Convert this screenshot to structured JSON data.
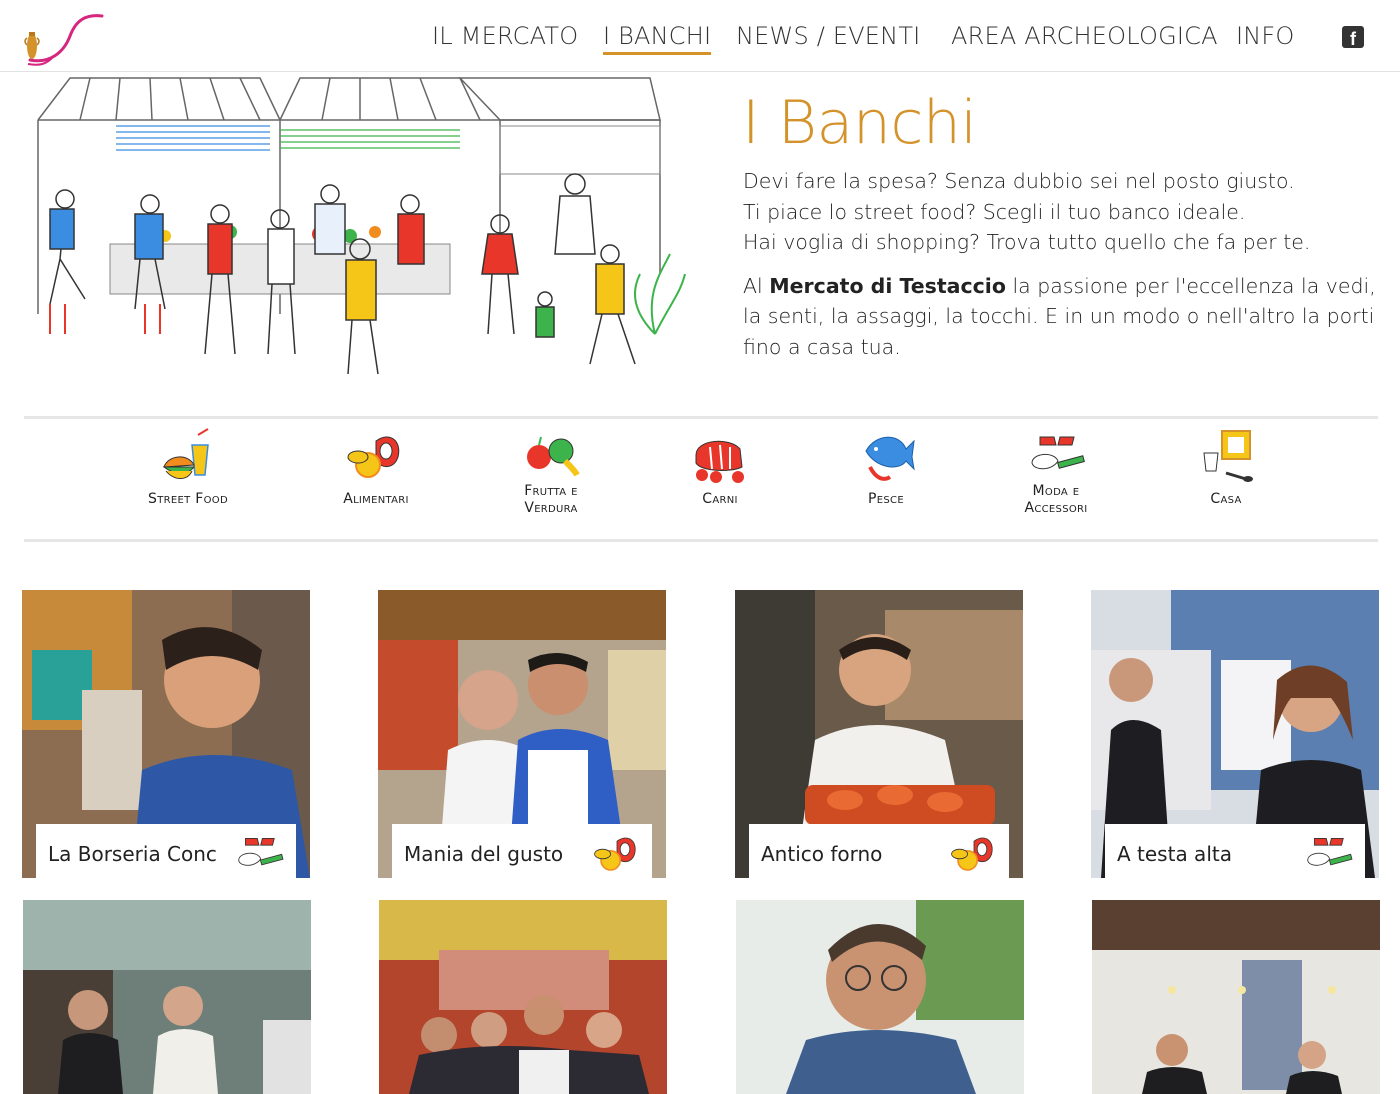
{
  "nav": {
    "items": [
      {
        "label": "IL MERCATO"
      },
      {
        "label": "I BANCHI"
      },
      {
        "label": "NEWS / EVENTI"
      },
      {
        "label": "AREA ARCHEOLOGICA"
      },
      {
        "label": "INFO"
      }
    ],
    "active_index": 1,
    "facebook_icon": "facebook-icon"
  },
  "hero": {
    "title": "I Banchi",
    "line1": "Devi fare la spesa? Senza dubbio sei nel posto giusto.",
    "line2": "Ti piace lo street food? Scegli il tuo banco ideale.",
    "line3": "Hai voglia di shopping? Trova tutto quello che fa per te.",
    "p2_pre": "Al ",
    "p2_bold": "Mercato di Testaccio",
    "p2_post": " la passione per l'eccellenza la vedi, la senti, la assaggi, la tocchi. E in un modo o nell'altro la porti fino a casa tua."
  },
  "categories": [
    {
      "line1": "Street Food",
      "line2": "",
      "icon": "street-food-icon"
    },
    {
      "line1": "Alimentari",
      "line2": "",
      "icon": "alimentari-icon"
    },
    {
      "line1": "Frutta e",
      "line2": "Verdura",
      "icon": "frutta-verdura-icon"
    },
    {
      "line1": "Carni",
      "line2": "",
      "icon": "carni-icon"
    },
    {
      "line1": "Pesce",
      "line2": "",
      "icon": "pesce-icon"
    },
    {
      "line1": "Moda e",
      "line2": "Accessori",
      "icon": "moda-accessori-icon"
    },
    {
      "line1": "Casa",
      "line2": "",
      "icon": "casa-icon"
    }
  ],
  "cards": [
    {
      "name": "La Borseria Conc",
      "icon": "moda-accessori-icon"
    },
    {
      "name": "Mania del gusto",
      "icon": "alimentari-icon"
    },
    {
      "name": "Antico forno",
      "icon": "alimentari-icon"
    },
    {
      "name": "A testa alta",
      "icon": "moda-accessori-icon"
    },
    {
      "name": "",
      "icon": ""
    },
    {
      "name": "",
      "icon": ""
    },
    {
      "name": "",
      "icon": ""
    },
    {
      "name": "",
      "icon": ""
    }
  ],
  "colors": {
    "accent": "#d4922a",
    "logo_magenta": "#d6267f",
    "divider": "#e6e6e6"
  }
}
